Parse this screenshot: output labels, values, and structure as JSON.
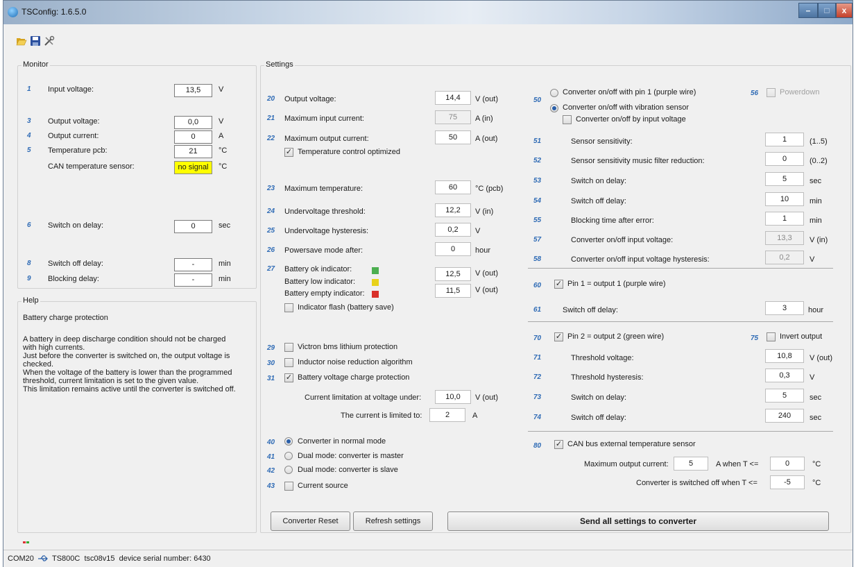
{
  "window": {
    "title": "TSConfig: 1.6.5.0",
    "min": "–",
    "max": "□",
    "close": "x"
  },
  "toolbar": {
    "open_icon": "folder-open-icon",
    "save_icon": "floppy-save-icon",
    "tools_icon": "tools-icon"
  },
  "monitor": {
    "title": "Monitor",
    "rows": [
      {
        "num": "1",
        "label": "Input voltage:",
        "value": "13,5",
        "unit": "V"
      },
      {
        "num": "3",
        "label": "Output voltage:",
        "value": "0,0",
        "unit": "V"
      },
      {
        "num": "4",
        "label": "Output current:",
        "value": "0",
        "unit": "A"
      },
      {
        "num": "5",
        "label": "Temperature pcb:",
        "value": "21",
        "unit": "°C"
      },
      {
        "num": "",
        "label": "CAN temperature sensor:",
        "value": "no signal",
        "unit": "°C"
      },
      {
        "num": "6",
        "label": "Switch on delay:",
        "value": "0",
        "unit": "sec"
      },
      {
        "num": "8",
        "label": "Switch off delay:",
        "value": "-",
        "unit": "min"
      },
      {
        "num": "9",
        "label": "Blocking delay:",
        "value": "-",
        "unit": "min"
      }
    ]
  },
  "help": {
    "title": "Help",
    "heading": "Battery charge protection",
    "lines": [
      "A battery in deep discharge condition should not be charged",
      "with high currents.",
      "Just before the converter is switched on, the output voltage is",
      "checked.",
      "When the voltage of the battery is lower than the programmed",
      "threshold, current limitation is set to the given value.",
      "This limitation remains active until the converter is switched off."
    ]
  },
  "settings": {
    "title": "Settings",
    "left": [
      {
        "num": "20",
        "label": "Output voltage:",
        "value": "14,4",
        "unit": "V (out)"
      },
      {
        "num": "21",
        "label": "Maximum input current:",
        "value": "75",
        "unit": "A (in)",
        "disabled": true
      },
      {
        "num": "22",
        "label": "Maximum output current:",
        "value": "50",
        "unit": "A (out)"
      },
      {
        "num": "23",
        "label": "Maximum temperature:",
        "value": "60",
        "unit": "°C (pcb)"
      },
      {
        "num": "24",
        "label": "Undervoltage threshold:",
        "value": "12,2",
        "unit": "V (in)"
      },
      {
        "num": "25",
        "label": "Undervoltage hysteresis:",
        "value": "0,2",
        "unit": "V"
      },
      {
        "num": "26",
        "label": "Powersave mode after:",
        "value": "0",
        "unit": "hour"
      }
    ],
    "temp_opt": {
      "label": "Temperature control optimized",
      "checked": "✓"
    },
    "battery": {
      "num": "27",
      "ok_label": "Battery ok indicator:",
      "ok_value": "12,5",
      "ok_unit": "V (out)",
      "ok_color": "#4caf50",
      "low_label": "Battery low indicator:",
      "low_color": "#e8d21a",
      "empty_label": "Battery empty indicator:",
      "empty_value": "11,5",
      "empty_unit": "V (out)",
      "empty_color": "#d9302a",
      "flash_label": "Indicator flash (battery save)"
    },
    "checks": [
      {
        "num": "29",
        "label": "Victron bms lithium protection",
        "checked": ""
      },
      {
        "num": "30",
        "label": "Inductor noise reduction algorithm",
        "checked": ""
      },
      {
        "num": "31",
        "label": "Battery voltage charge protection",
        "checked": "✓"
      }
    ],
    "limit": {
      "label1": "Current limitation at voltage under:",
      "value1": "10,0",
      "unit1": "V (out)",
      "label2": "The current is limited to:",
      "value2": "2",
      "unit2": "A"
    },
    "modes": [
      {
        "num": "40",
        "label": "Converter in normal mode",
        "on": true
      },
      {
        "num": "41",
        "label": "Dual mode: converter is master",
        "on": false
      },
      {
        "num": "42",
        "label": "Dual mode: converter is slave",
        "on": false
      }
    ],
    "current_source": {
      "num": "43",
      "label": "Current source"
    },
    "right_top": {
      "num50": "50",
      "pin1_label": "Converter on/off with pin 1 (purple wire)",
      "vib_label": "Converter on/off with vibration sensor",
      "inputv_label": "Converter on/off by input voltage",
      "num56": "56",
      "powerdown_label": "Powerdown"
    },
    "right": [
      {
        "num": "51",
        "label": "Sensor sensitivity:",
        "value": "1",
        "unit": "(1..5)"
      },
      {
        "num": "52",
        "label": "Sensor sensitivity music filter reduction:",
        "value": "0",
        "unit": "(0..2)"
      },
      {
        "num": "53",
        "label": "Switch on delay:",
        "value": "5",
        "unit": "sec"
      },
      {
        "num": "54",
        "label": "Switch off delay:",
        "value": "10",
        "unit": "min"
      },
      {
        "num": "55",
        "label": "Blocking time after error:",
        "value": "1",
        "unit": "min"
      },
      {
        "num": "57",
        "label": "Converter on/off input voltage:",
        "value": "13,3",
        "unit": "V (in)",
        "disabled": true
      },
      {
        "num": "58",
        "label": "Converter on/off input voltage hysteresis:",
        "value": "0,2",
        "unit": "V",
        "disabled": true
      }
    ],
    "pin1": {
      "num": "60",
      "label": "Pin 1 = output 1 (purple wire)",
      "num61": "61",
      "off_label": "Switch off delay:",
      "off_value": "3",
      "off_unit": "hour"
    },
    "pin2": {
      "num": "70",
      "label": "Pin 2 = output 2 (green wire)",
      "num75": "75",
      "invert_label": "Invert output",
      "rows": [
        {
          "num": "71",
          "label": "Threshold voltage:",
          "value": "10,8",
          "unit": "V (out)"
        },
        {
          "num": "72",
          "label": "Threshold hysteresis:",
          "value": "0,3",
          "unit": "V"
        },
        {
          "num": "73",
          "label": "Switch on delay:",
          "value": "5",
          "unit": "sec"
        },
        {
          "num": "74",
          "label": "Switch off delay:",
          "value": "240",
          "unit": "sec"
        }
      ]
    },
    "can": {
      "num": "80",
      "label": "CAN bus external temperature sensor",
      "max_label": "Maximum output current:",
      "max_value": "5",
      "when_label": "A when T <=",
      "when_value": "0",
      "when_unit": "°C",
      "off_label": "Converter is switched off when T <=",
      "off_value": "-5",
      "off_unit": "°C"
    },
    "buttons": {
      "reset": "Converter Reset",
      "refresh": "Refresh settings",
      "send": "Send all settings to converter"
    }
  },
  "status": {
    "port": "COM20",
    "usb_icon": "usb-icon",
    "text": "TS800C  tsc08v15  device serial number: 6430"
  }
}
